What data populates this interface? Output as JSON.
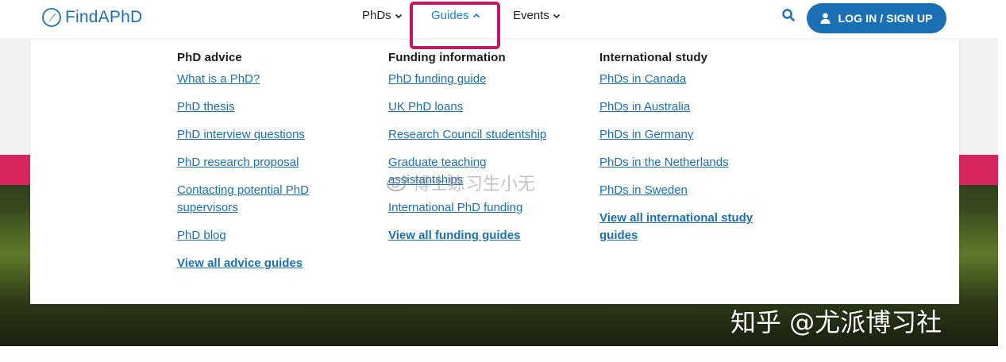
{
  "brand": {
    "name": "FindAPhD"
  },
  "nav": {
    "items": [
      {
        "label": "PhDs",
        "expanded": false
      },
      {
        "label": "Guides",
        "expanded": true
      },
      {
        "label": "Events",
        "expanded": false
      }
    ],
    "login_label": "LOG IN / SIGN UP"
  },
  "colors": {
    "brand_blue": "#1b6fb5",
    "highlight": "#c2186b",
    "pink_band": "#d6265d"
  },
  "dropdown": {
    "columns": [
      {
        "heading": "PhD advice",
        "links": [
          "What is a PhD?",
          "PhD thesis",
          "PhD interview questions",
          "PhD research proposal",
          "Contacting potential PhD supervisors",
          "PhD blog"
        ],
        "view_all": "View all advice guides"
      },
      {
        "heading": "Funding information",
        "links": [
          "PhD funding guide",
          "UK PhD loans",
          "Research Council studentship",
          "Graduate teaching assistantships",
          "International PhD funding"
        ],
        "view_all": "View all funding guides"
      },
      {
        "heading": "International study",
        "links": [
          "PhDs in Canada",
          "PhDs in Australia",
          "PhDs in Germany",
          "PhDs in the Netherlands",
          "PhDs in Sweden"
        ],
        "view_all": "View all international study guides"
      }
    ]
  },
  "watermarks": {
    "center": "博士练习生小无",
    "corner": "知乎 @尤派博习社"
  },
  "icons": [
    "compass-logo-icon",
    "chevron-down-icon",
    "chevron-up-icon",
    "search-icon",
    "user-icon",
    "weibo-icon"
  ]
}
